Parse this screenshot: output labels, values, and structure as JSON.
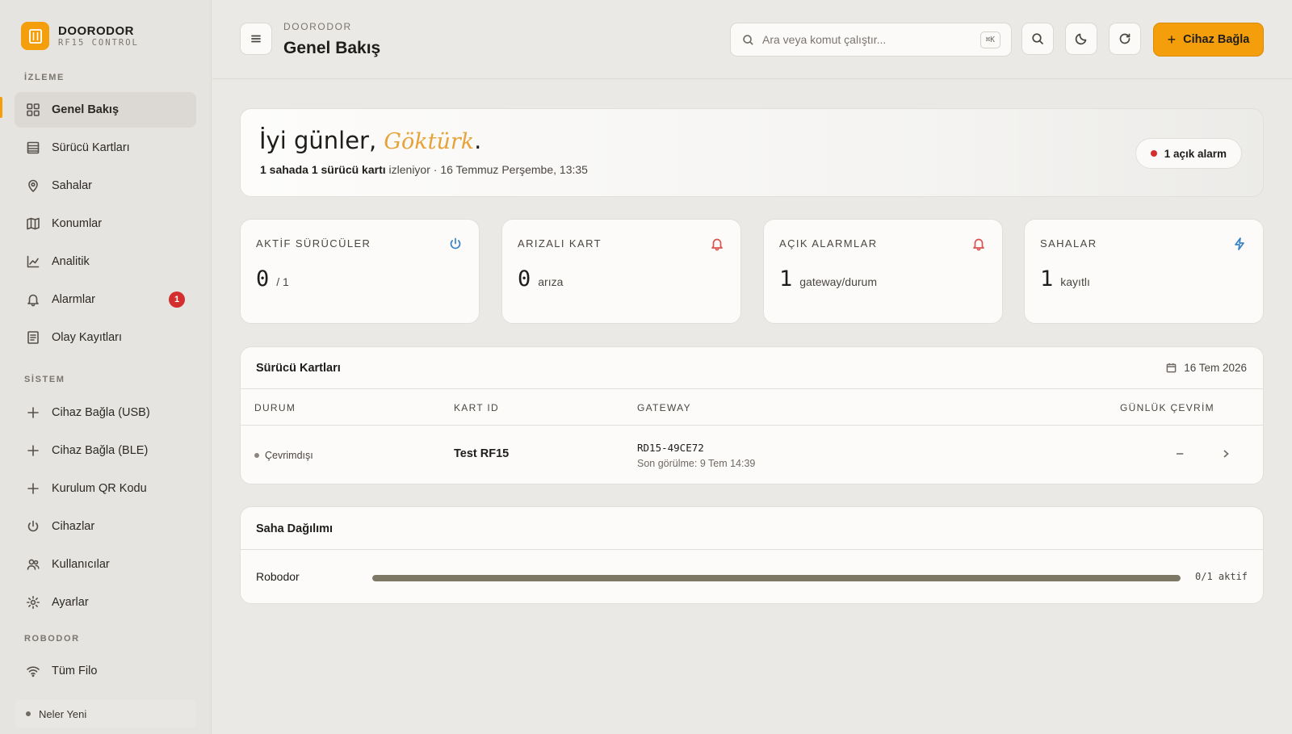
{
  "brand": {
    "name": "DOORODOR",
    "subtitle": "RF15 CONTROL",
    "logo_icon": "door-icon",
    "accent": "#f59e0b"
  },
  "sidebar": {
    "sections": [
      {
        "label": "İZLEME"
      },
      {
        "label": "SİSTEM"
      },
      {
        "label": "ROBODOR"
      }
    ],
    "items": [
      {
        "label": "Genel Bakış",
        "icon": "grid-icon",
        "active": true
      },
      {
        "label": "Sürücü Kartları",
        "icon": "list-icon"
      },
      {
        "label": "Sahalar",
        "icon": "map-pin-icon"
      },
      {
        "label": "Konumlar",
        "icon": "map-icon"
      },
      {
        "label": "Analitik",
        "icon": "chart-line-icon"
      },
      {
        "label": "Alarmlar",
        "icon": "bell-icon",
        "badge": "1"
      },
      {
        "label": "Olay Kayıtları",
        "icon": "log-icon"
      },
      {
        "label": "Cihaz Bağla (USB)",
        "icon": "plus-icon"
      },
      {
        "label": "Cihaz Bağla (BLE)",
        "icon": "plus-icon"
      },
      {
        "label": "Kurulum QR Kodu",
        "icon": "plus-icon"
      },
      {
        "label": "Cihazlar",
        "icon": "power-icon"
      },
      {
        "label": "Kullanıcılar",
        "icon": "users-icon"
      },
      {
        "label": "Ayarlar",
        "icon": "gear-icon"
      },
      {
        "label": "Tüm Filo",
        "icon": "wifi-icon"
      }
    ],
    "whats_new": "Neler Yeni"
  },
  "header": {
    "breadcrumb": "DOORODOR",
    "title": "Genel Bakış",
    "search_placeholder": "Ara veya komut çalıştır...",
    "search_shortcut": "⌘K",
    "primary_button": "Cihaz Bağla"
  },
  "hero": {
    "greeting": "İyi günler,",
    "name": "Göktürk",
    "punct": ".",
    "summary_bold": "1 sahada 1 sürücü kartı",
    "summary_rest": " izleniyor · 16 Temmuz Perşembe, 13:35",
    "alarm_pill": "1 açık alarm"
  },
  "stats": [
    {
      "label": "AKTİF SÜRÜCÜLER",
      "value": "0",
      "unit": "/ 1",
      "icon": "power-icon",
      "icon_color": "#3b82c4"
    },
    {
      "label": "ARIZALI KART",
      "value": "0",
      "unit": "arıza",
      "icon": "bell-icon",
      "icon_color": "#d9534f"
    },
    {
      "label": "AÇIK ALARMLAR",
      "value": "1",
      "unit": "gateway/durum",
      "icon": "bell-icon",
      "icon_color": "#d9534f"
    },
    {
      "label": "SAHALAR",
      "value": "1",
      "unit": "kayıtlı",
      "icon": "bolt-icon",
      "icon_color": "#3b82c4"
    }
  ],
  "drivers_table": {
    "title": "Sürücü Kartları",
    "date": "16 Tem 2026",
    "columns": [
      "DURUM",
      "KART ID",
      "GATEWAY",
      "GÜNLÜK ÇEVRİM"
    ],
    "rows": [
      {
        "status": "Çevrimdışı",
        "kart_id": "Test RF15",
        "gateway": "RD15-49CE72",
        "last_seen": "Son görülme: 9 Tem 14:39",
        "daily": "–"
      }
    ]
  },
  "distribution": {
    "title": "Saha Dağılımı",
    "rows": [
      {
        "name": "Robodor",
        "value_text": "0/1 aktif",
        "fill_fraction": 1.0
      }
    ]
  }
}
